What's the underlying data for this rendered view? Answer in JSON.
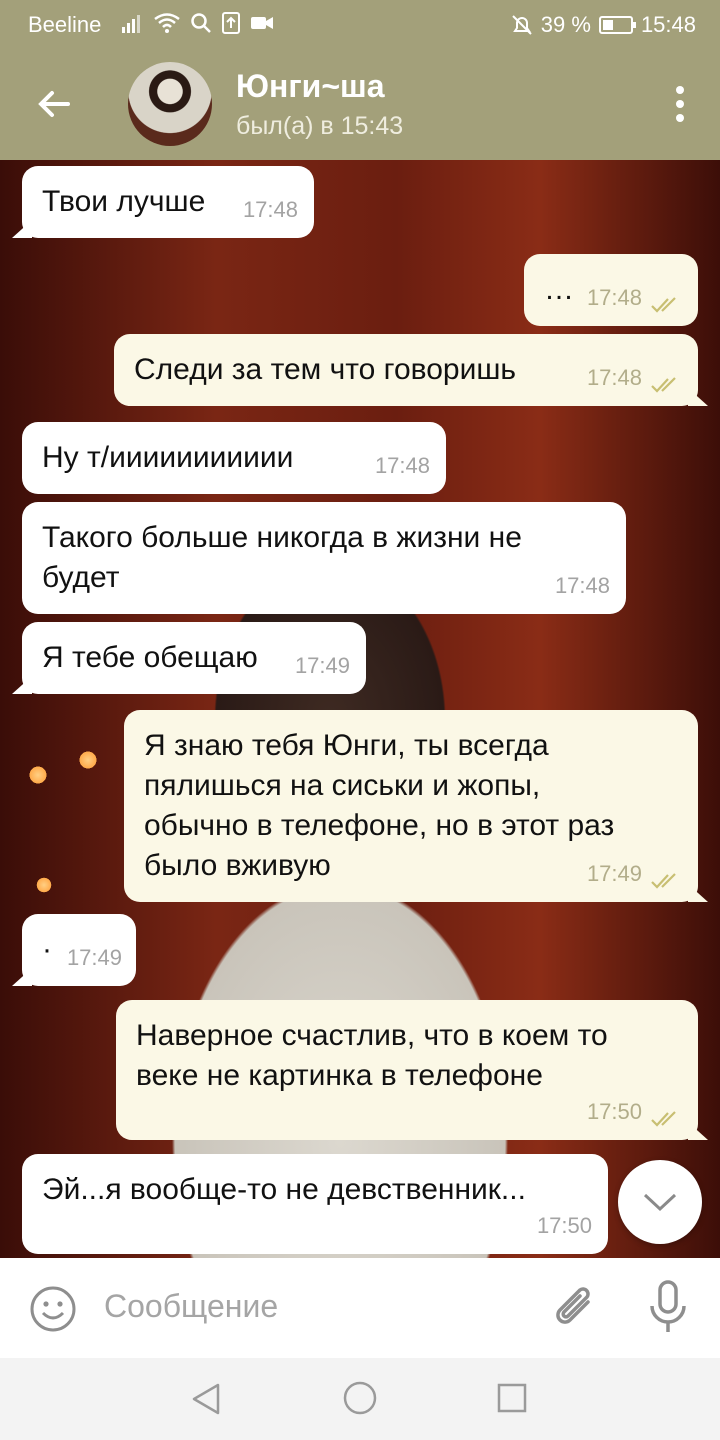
{
  "status_bar": {
    "carrier": "Beeline",
    "battery": "39 %",
    "time": "15:48",
    "battery_level": 0.39
  },
  "header": {
    "contact_name": "Юнги~ша",
    "last_seen": "был(а) в 15:43"
  },
  "messages": [
    {
      "direction": "in",
      "text": "Твои лучше",
      "time": "17:48"
    },
    {
      "direction": "out",
      "text": "…",
      "time": "17:48",
      "read": true
    },
    {
      "direction": "out",
      "text": "Следи за тем что говоришь",
      "time": "17:48",
      "read": true
    },
    {
      "direction": "in",
      "text": "Ну т/иииииииииии",
      "time": "17:48"
    },
    {
      "direction": "in",
      "text_lines": [
        "Такого больше никогда в жизни не",
        "будет"
      ],
      "time": "17:48"
    },
    {
      "direction": "in",
      "text": "Я тебе обещаю",
      "time": "17:49"
    },
    {
      "direction": "out",
      "text_lines": [
        "Я знаю тебя Юнги, ты всегда",
        "пялишься на сиськи и жопы,",
        "обычно в телефоне, но в этот раз",
        "было вживую"
      ],
      "time": "17:49",
      "read": true
    },
    {
      "direction": "in",
      "text": "·",
      "time": "17:49"
    },
    {
      "direction": "out",
      "text_lines": [
        "Наверное счастлив, что в коем то",
        "веке не картинка в телефоне"
      ],
      "time": "17:50",
      "read": true
    },
    {
      "direction": "in",
      "text": "Эй...я вообще-то не девственник...",
      "time": "17:50"
    }
  ],
  "input": {
    "placeholder": "Сообщение"
  },
  "colors": {
    "header": "#a3a07a",
    "bubble_in": "#ffffff",
    "bubble_out": "#fbf8e6",
    "read_ticks": "#c8bf72"
  },
  "icons": {
    "back": "arrow-left-icon",
    "menu": "more-vertical-icon",
    "emoji": "smiley-icon",
    "attach": "paperclip-icon",
    "mic": "microphone-icon",
    "scroll": "chevron-down-icon"
  }
}
